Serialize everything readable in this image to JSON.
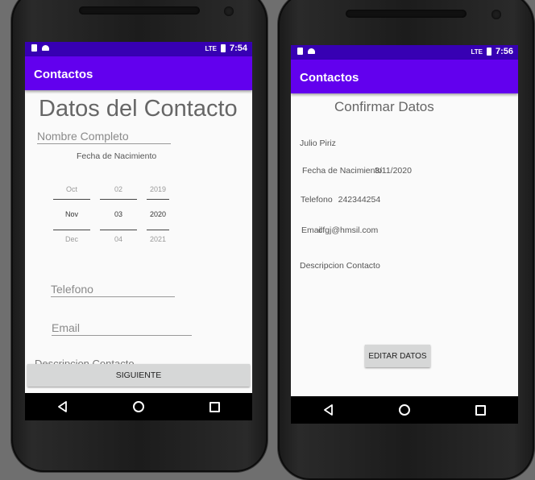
{
  "phone1": {
    "status": {
      "time": "7:54",
      "network": "LTE"
    },
    "app_title": "Contactos",
    "form": {
      "title": "Datos del Contacto",
      "name_placeholder": "Nombre Completo",
      "date_label": "Fecha de Nacimiento",
      "date_picker": {
        "month": {
          "prev": "Oct",
          "selected": "Nov",
          "next": "Dec"
        },
        "day": {
          "prev": "02",
          "selected": "03",
          "next": "04"
        },
        "year": {
          "prev": "2019",
          "selected": "2020",
          "next": "2021"
        }
      },
      "phone_placeholder": "Telefono",
      "email_placeholder": "Email",
      "description_placeholder": "Descripcion Contacto",
      "next_button": "SIGUIENTE"
    }
  },
  "phone2": {
    "status": {
      "time": "7:56",
      "network": "LTE"
    },
    "app_title": "Contactos",
    "confirm": {
      "title": "Confirmar Datos",
      "name": "Julio Piriz",
      "birth_label": "Fecha de Nacimiento",
      "birth_value": "3/11/2020",
      "phone_label": "Telefono",
      "phone_value": "242344254",
      "email_label": "Email",
      "email_value": "cfgj@hmsil.com",
      "description_label": "Descripcion Contacto",
      "edit_button": "EDITAR DATOS"
    }
  }
}
